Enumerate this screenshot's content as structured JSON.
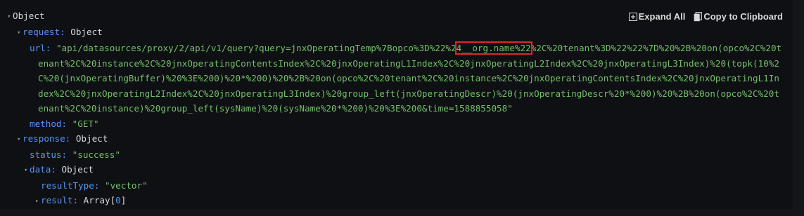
{
  "toolbar": {
    "expand_label": "Expand All",
    "copy_label": "Copy to Clipboard"
  },
  "tree": {
    "root": "Object",
    "request_key": "request:",
    "request_val": "Object",
    "url_key": "url:",
    "url_prefix": "\"api/datasources/proxy/2/api/v1/query?query=jnxOperatingTemp%7Bopco%3D%22%2",
    "url_highlight": "4__org.name%22",
    "url_suffix": "%2C%20tenant%3D%22%22%7D%20%2B%20on(opco%2C%20tenant%2C%20instance%2C%20jnxOperatingContentsIndex%2C%20jnxOperatingL1Index%2C%20jnxOperatingL2Index%2C%20jnxOperatingL3Index)%20(topk(10%2C%20(jnxOperatingBuffer)%20%3E%200)%20*%200)%20%2B%20on(opco%2C%20tenant%2C%20instance%2C%20jnxOperatingContentsIndex%2C%20jnxOperatingL1Index%2C%20jnxOperatingL2Index%2C%20jnxOperatingL3Index)%20group_left(jnxOperatingDescr)%20(jnxOperatingDescr%20*%200)%20%2B%20on(opco%2C%20tenant%2C%20instance)%20group_left(sysName)%20(sysName%20*%200)%20%3E%200&time=1588855058\"",
    "method_key": "method:",
    "method_val": "\"GET\"",
    "response_key": "response:",
    "response_val": "Object",
    "status_key": "status:",
    "status_val": "\"success\"",
    "data_key": "data:",
    "data_val": "Object",
    "resultType_key": "resultType:",
    "resultType_val": "\"vector\"",
    "result_key": "result:",
    "result_val_prefix": "Array[",
    "result_val_num": "0",
    "result_val_suffix": "]"
  }
}
